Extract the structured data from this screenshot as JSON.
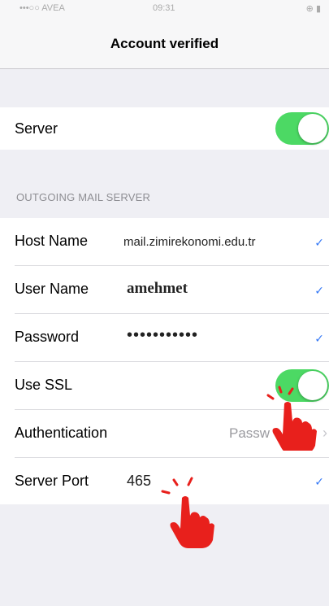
{
  "statusbar": {
    "carrier": "•••○○ AVEA",
    "time": "09:31",
    "right": "⊕ ▮"
  },
  "navbar": {
    "title": "Account verified"
  },
  "server": {
    "label": "Server",
    "enabled": true
  },
  "outgoing": {
    "header": "OUTGOING MAIL SERVER"
  },
  "host": {
    "label": "Host Name",
    "value": "mail.zimirekonomi.edu.tr"
  },
  "username": {
    "label": "User Name",
    "value": "amehmet"
  },
  "password": {
    "label": "Password",
    "value": "•••••••••••"
  },
  "ssl": {
    "label": "Use SSL",
    "enabled": true
  },
  "auth": {
    "label": "Authentication",
    "value": "Passw"
  },
  "port": {
    "label": "Server Port",
    "value": "465"
  },
  "icons": {
    "check": "checkmark-icon",
    "chevron": "chevron-right-icon",
    "hand": "tap-hand-icon"
  },
  "colors": {
    "toggle_on": "#4cd964",
    "accent": "#3478f6",
    "hand": "#e8201c"
  }
}
